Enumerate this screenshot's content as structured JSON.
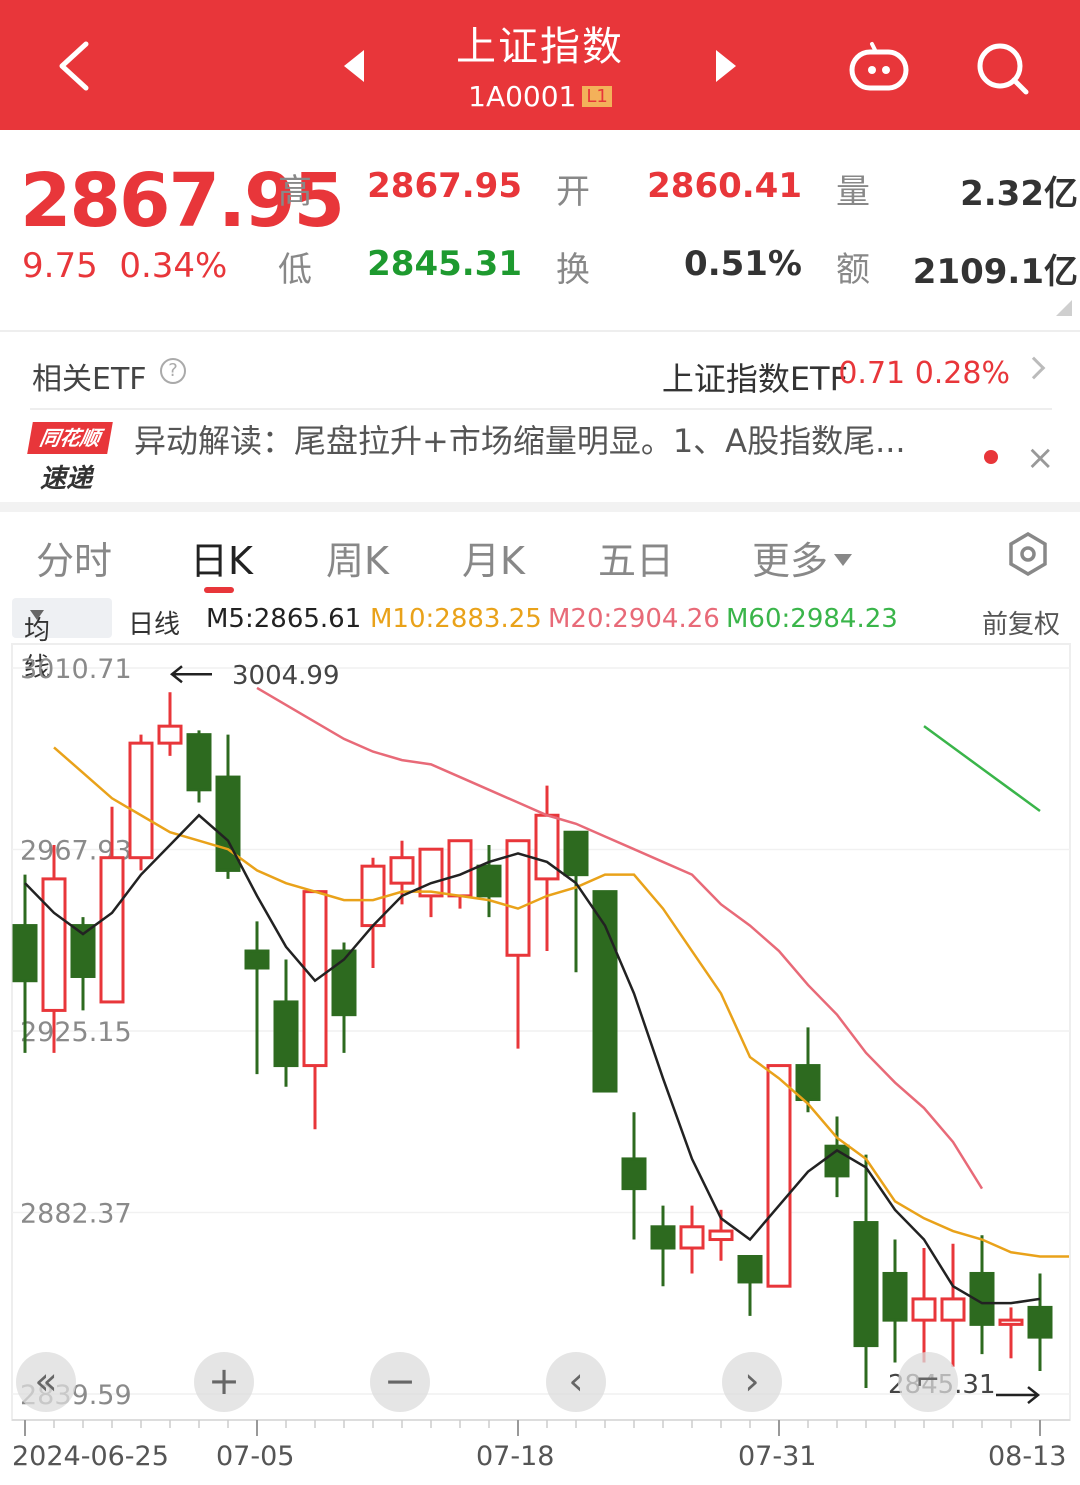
{
  "header": {
    "title": "上证指数",
    "code": "1A0001",
    "level_badge": "L1",
    "icons": [
      "back-arrow-icon",
      "prev-triangle-icon",
      "next-triangle-icon",
      "robot-icon",
      "search-icon"
    ]
  },
  "quote": {
    "price": "2867.95",
    "change": "9.75",
    "change_pct": "0.34%",
    "high_label": "高",
    "high": "2867.95",
    "open_label": "开",
    "open": "2860.41",
    "volume_label": "量",
    "volume": "2.32亿",
    "low_label": "低",
    "low": "2845.31",
    "turnover_label": "换",
    "turnover": "0.51%",
    "amount_label": "额",
    "amount": "2109.1亿"
  },
  "etf": {
    "label": "相关ETF",
    "help": "?",
    "name": "上证指数ETF",
    "value": "0.71",
    "pct": "0.28%"
  },
  "news": {
    "logo_top": "同花顺",
    "logo_bottom": "速递",
    "text": "异动解读：尾盘拉升+市场缩量明显。1、A股指数尾...",
    "close": "×"
  },
  "tabs": {
    "items": [
      "分时",
      "日K",
      "周K",
      "月K",
      "五日",
      "更多"
    ],
    "active": "日K"
  },
  "ma_bar": {
    "selector": "均线",
    "period": "日线",
    "m5": "M5:2865.61",
    "m10": "M10:2883.25",
    "m20": "M20:2904.26",
    "m60": "M60:2984.23",
    "adjust": "前复权"
  },
  "colors": {
    "up": "#e8363a",
    "down": "#2d6a1f",
    "m5": "#222222",
    "m10": "#e9a21a",
    "m20": "#e86a78",
    "m60": "#3ab54a",
    "header_bg": "#e8363a"
  },
  "chart_data": {
    "type": "candlestick",
    "price_range": [
      2839.59,
      3010.71
    ],
    "y_ticks": [
      "3010.71",
      "2967.93",
      "2925.15",
      "2882.37",
      "2839.59"
    ],
    "x_ticks": [
      "2024-06-25",
      "07-05",
      "07-18",
      "07-31",
      "08-13"
    ],
    "high_annotation": "3004.99",
    "low_annotation": "2845.31",
    "candles": [
      {
        "o": 2950,
        "h": 2962,
        "c": 2937,
        "l": 2920
      },
      {
        "o": 2930,
        "h": 2969,
        "c": 2961,
        "l": 2920
      },
      {
        "o": 2950,
        "h": 2952,
        "c": 2938,
        "l": 2930
      },
      {
        "o": 2932,
        "h": 2978,
        "c": 2966,
        "l": 2932
      },
      {
        "o": 2966,
        "h": 2995,
        "c": 2993,
        "l": 2963
      },
      {
        "o": 2993,
        "h": 3005,
        "c": 2997,
        "l": 2990
      },
      {
        "o": 2995,
        "h": 2996,
        "c": 2982,
        "l": 2979
      },
      {
        "o": 2985,
        "h": 2995,
        "c": 2963,
        "l": 2961
      },
      {
        "o": 2944,
        "h": 2951,
        "c": 2940,
        "l": 2915
      },
      {
        "o": 2932,
        "h": 2942,
        "c": 2917,
        "l": 2912
      },
      {
        "o": 2917,
        "h": 2952,
        "c": 2958,
        "l": 2902
      },
      {
        "o": 2944,
        "h": 2946,
        "c": 2929,
        "l": 2920
      },
      {
        "o": 2950,
        "h": 2966,
        "c": 2964,
        "l": 2940
      },
      {
        "o": 2960,
        "h": 2970,
        "c": 2966,
        "l": 2955
      },
      {
        "o": 2957,
        "h": 2968,
        "c": 2968,
        "l": 2952
      },
      {
        "o": 2957,
        "h": 2970,
        "c": 2970,
        "l": 2954
      },
      {
        "o": 2964,
        "h": 2969,
        "c": 2957,
        "l": 2952
      },
      {
        "o": 2943,
        "h": 2970,
        "c": 2970,
        "l": 2921
      },
      {
        "o": 2961,
        "h": 2983,
        "c": 2976,
        "l": 2944
      },
      {
        "o": 2972,
        "h": 2972,
        "c": 2962,
        "l": 2939
      },
      {
        "o": 2958,
        "h": 2958,
        "c": 2911,
        "l": 2911
      },
      {
        "o": 2895,
        "h": 2906,
        "c": 2888,
        "l": 2876
      },
      {
        "o": 2879,
        "h": 2884,
        "c": 2874,
        "l": 2865
      },
      {
        "o": 2874,
        "h": 2884,
        "c": 2879,
        "l": 2868
      },
      {
        "o": 2876,
        "h": 2883,
        "c": 2878,
        "l": 2871
      },
      {
        "o": 2872,
        "h": 2872,
        "c": 2866,
        "l": 2858
      },
      {
        "o": 2865,
        "h": 2915,
        "c": 2917,
        "l": 2865
      },
      {
        "o": 2917,
        "h": 2926,
        "c": 2909,
        "l": 2906
      },
      {
        "o": 2898,
        "h": 2905,
        "c": 2891,
        "l": 2886
      },
      {
        "o": 2880,
        "h": 2896,
        "c": 2851,
        "l": 2841
      },
      {
        "o": 2868,
        "h": 2876,
        "c": 2857,
        "l": 2847
      },
      {
        "o": 2857,
        "h": 2874,
        "c": 2862,
        "l": 2847
      },
      {
        "o": 2857,
        "h": 2875,
        "c": 2862,
        "l": 2846
      },
      {
        "o": 2868,
        "h": 2877,
        "c": 2856,
        "l": 2849
      },
      {
        "o": 2856,
        "h": 2860,
        "c": 2857,
        "l": 2848
      },
      {
        "o": 2860,
        "h": 2868,
        "c": 2853,
        "l": 2845
      }
    ],
    "m5": [
      2960,
      2953,
      2948,
      2953,
      2962,
      2969,
      2976,
      2970,
      2957,
      2945,
      2937,
      2942,
      2950,
      2957,
      2960,
      2962,
      2965,
      2967,
      2965,
      2960,
      2950,
      2934,
      2914,
      2895,
      2881,
      2876,
      2884,
      2892,
      2897,
      2893,
      2883,
      2876,
      2865,
      2861,
      2861,
      2862
    ],
    "m10": [
      2992,
      2986,
      2980,
      2976,
      2972,
      2970,
      2968,
      2963,
      2960,
      2958,
      2956,
      2956,
      2958,
      2958,
      2957,
      2956,
      2954,
      2957,
      2959,
      2962,
      2962,
      2954,
      2944,
      2934,
      2919,
      2914,
      2908,
      2900,
      2895,
      2885,
      2881,
      2878,
      2876,
      2873,
      2872,
      2872
    ],
    "m20": [
      3006,
      3002,
      2998,
      2994,
      2991,
      2989,
      2988,
      2985,
      2982,
      2979,
      2976,
      2974,
      2971,
      2968,
      2965,
      2962,
      2955,
      2950,
      2944,
      2936,
      2929,
      2920,
      2913,
      2907,
      2899,
      2888
    ],
    "m60": [
      2997,
      2992,
      2987,
      2982,
      2977
    ]
  }
}
